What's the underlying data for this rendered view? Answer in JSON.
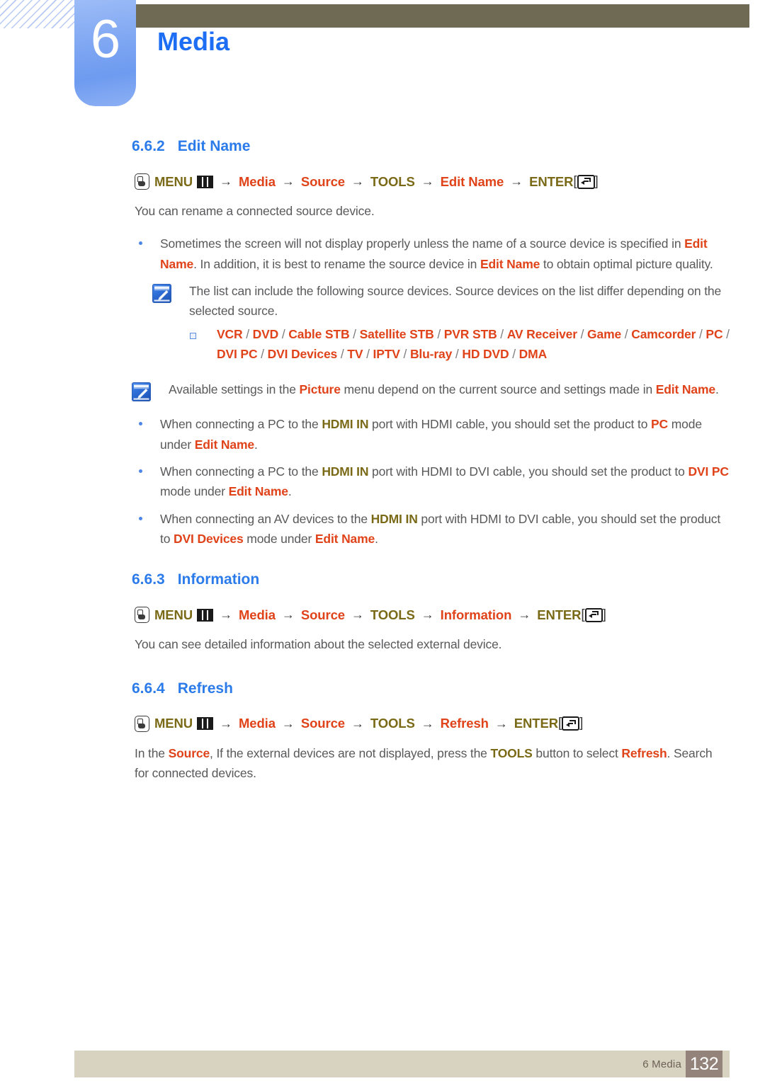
{
  "header": {
    "chapter_number": "6",
    "chapter_title": "Media",
    "accent_blue": "#1d6ef4",
    "tab_blue": "#7ca5f2",
    "olive_bar": "#6e6a54"
  },
  "sections": [
    {
      "num": "6.6.2",
      "title": "Edit Name",
      "menu_path": {
        "menu_label": "MENU",
        "steps": [
          "Media",
          "Source",
          "TOOLS",
          "Edit Name"
        ],
        "enter_label": "ENTER",
        "arrow": "→",
        "bracket_open": "[",
        "bracket_close": "]"
      },
      "intro": "You can rename a connected source device.",
      "bullets": [
        {
          "parts": [
            {
              "t": "Sometimes the screen will not display properly unless the name of a source device is specified in ",
              "s": "plain"
            },
            {
              "t": "Edit Name",
              "s": "orange"
            },
            {
              "t": ". In addition, it is best to rename the source device in ",
              "s": "plain"
            },
            {
              "t": "Edit Name",
              "s": "orange"
            },
            {
              "t": " to obtain optimal picture quality.",
              "s": "plain"
            }
          ]
        }
      ],
      "note": {
        "parts": [
          {
            "t": "The list can include the following source devices. Source devices on the list differ depending on the selected source.",
            "s": "plain"
          }
        ],
        "device_list": [
          "VCR",
          "DVD",
          "Cable STB",
          "Satellite STB",
          "PVR STB",
          "AV Receiver",
          "Game",
          "Camcorder",
          "PC",
          "DVI PC",
          "DVI Devices",
          "TV",
          "IPTV",
          "Blu-ray",
          "HD DVD",
          "DMA"
        ],
        "device_separator": "/"
      },
      "note2": {
        "parts": [
          {
            "t": "Available settings in the ",
            "s": "plain"
          },
          {
            "t": "Picture",
            "s": "orange"
          },
          {
            "t": " menu depend on the current source and settings made in ",
            "s": "plain"
          },
          {
            "t": "Edit Name",
            "s": "orange"
          },
          {
            "t": ".",
            "s": "plain"
          }
        ]
      },
      "bullets2": [
        {
          "parts": [
            {
              "t": "When connecting a PC to the ",
              "s": "plain"
            },
            {
              "t": "HDMI IN",
              "s": "olive"
            },
            {
              "t": " port with HDMI cable, you should set the product to ",
              "s": "plain"
            },
            {
              "t": "PC",
              "s": "orange"
            },
            {
              "t": " mode under ",
              "s": "plain"
            },
            {
              "t": "Edit Name",
              "s": "orange"
            },
            {
              "t": ".",
              "s": "plain"
            }
          ]
        },
        {
          "parts": [
            {
              "t": "When connecting a PC to the ",
              "s": "plain"
            },
            {
              "t": "HDMI IN",
              "s": "olive"
            },
            {
              "t": " port with HDMI to DVI cable, you should set the product to ",
              "s": "plain"
            },
            {
              "t": "DVI PC",
              "s": "orange"
            },
            {
              "t": " mode under ",
              "s": "plain"
            },
            {
              "t": "Edit Name",
              "s": "orange"
            },
            {
              "t": ".",
              "s": "plain"
            }
          ]
        },
        {
          "parts": [
            {
              "t": "When connecting an AV devices to the ",
              "s": "plain"
            },
            {
              "t": "HDMI IN",
              "s": "olive"
            },
            {
              "t": " port with HDMI to DVI cable, you should set the product to ",
              "s": "plain"
            },
            {
              "t": "DVI Devices",
              "s": "orange"
            },
            {
              "t": " mode under ",
              "s": "plain"
            },
            {
              "t": "Edit Name",
              "s": "orange"
            },
            {
              "t": ".",
              "s": "plain"
            }
          ]
        }
      ]
    },
    {
      "num": "6.6.3",
      "title": "Information",
      "menu_path": {
        "menu_label": "MENU",
        "steps": [
          "Media",
          "Source",
          "TOOLS",
          "Information"
        ],
        "enter_label": "ENTER",
        "arrow": "→",
        "bracket_open": "[",
        "bracket_close": "]"
      },
      "intro": "You can see detailed information about the selected external device."
    },
    {
      "num": "6.6.4",
      "title": "Refresh",
      "menu_path": {
        "menu_label": "MENU",
        "steps": [
          "Media",
          "Source",
          "TOOLS",
          "Refresh"
        ],
        "enter_label": "ENTER",
        "arrow": "→",
        "bracket_open": "[",
        "bracket_close": "]"
      },
      "outro": {
        "parts": [
          {
            "t": "In the ",
            "s": "plain"
          },
          {
            "t": "Source",
            "s": "orange"
          },
          {
            "t": ", If the external devices are not displayed, press the ",
            "s": "plain"
          },
          {
            "t": "TOOLS",
            "s": "olive"
          },
          {
            "t": " button to select ",
            "s": "plain"
          },
          {
            "t": "Refresh",
            "s": "orange"
          },
          {
            "t": ". Search for connected devices.",
            "s": "plain"
          }
        ]
      }
    }
  ],
  "footer": {
    "label": "6 Media",
    "page_number": "132",
    "bar_color": "#d8d3c0",
    "page_box_color": "#93837b"
  }
}
